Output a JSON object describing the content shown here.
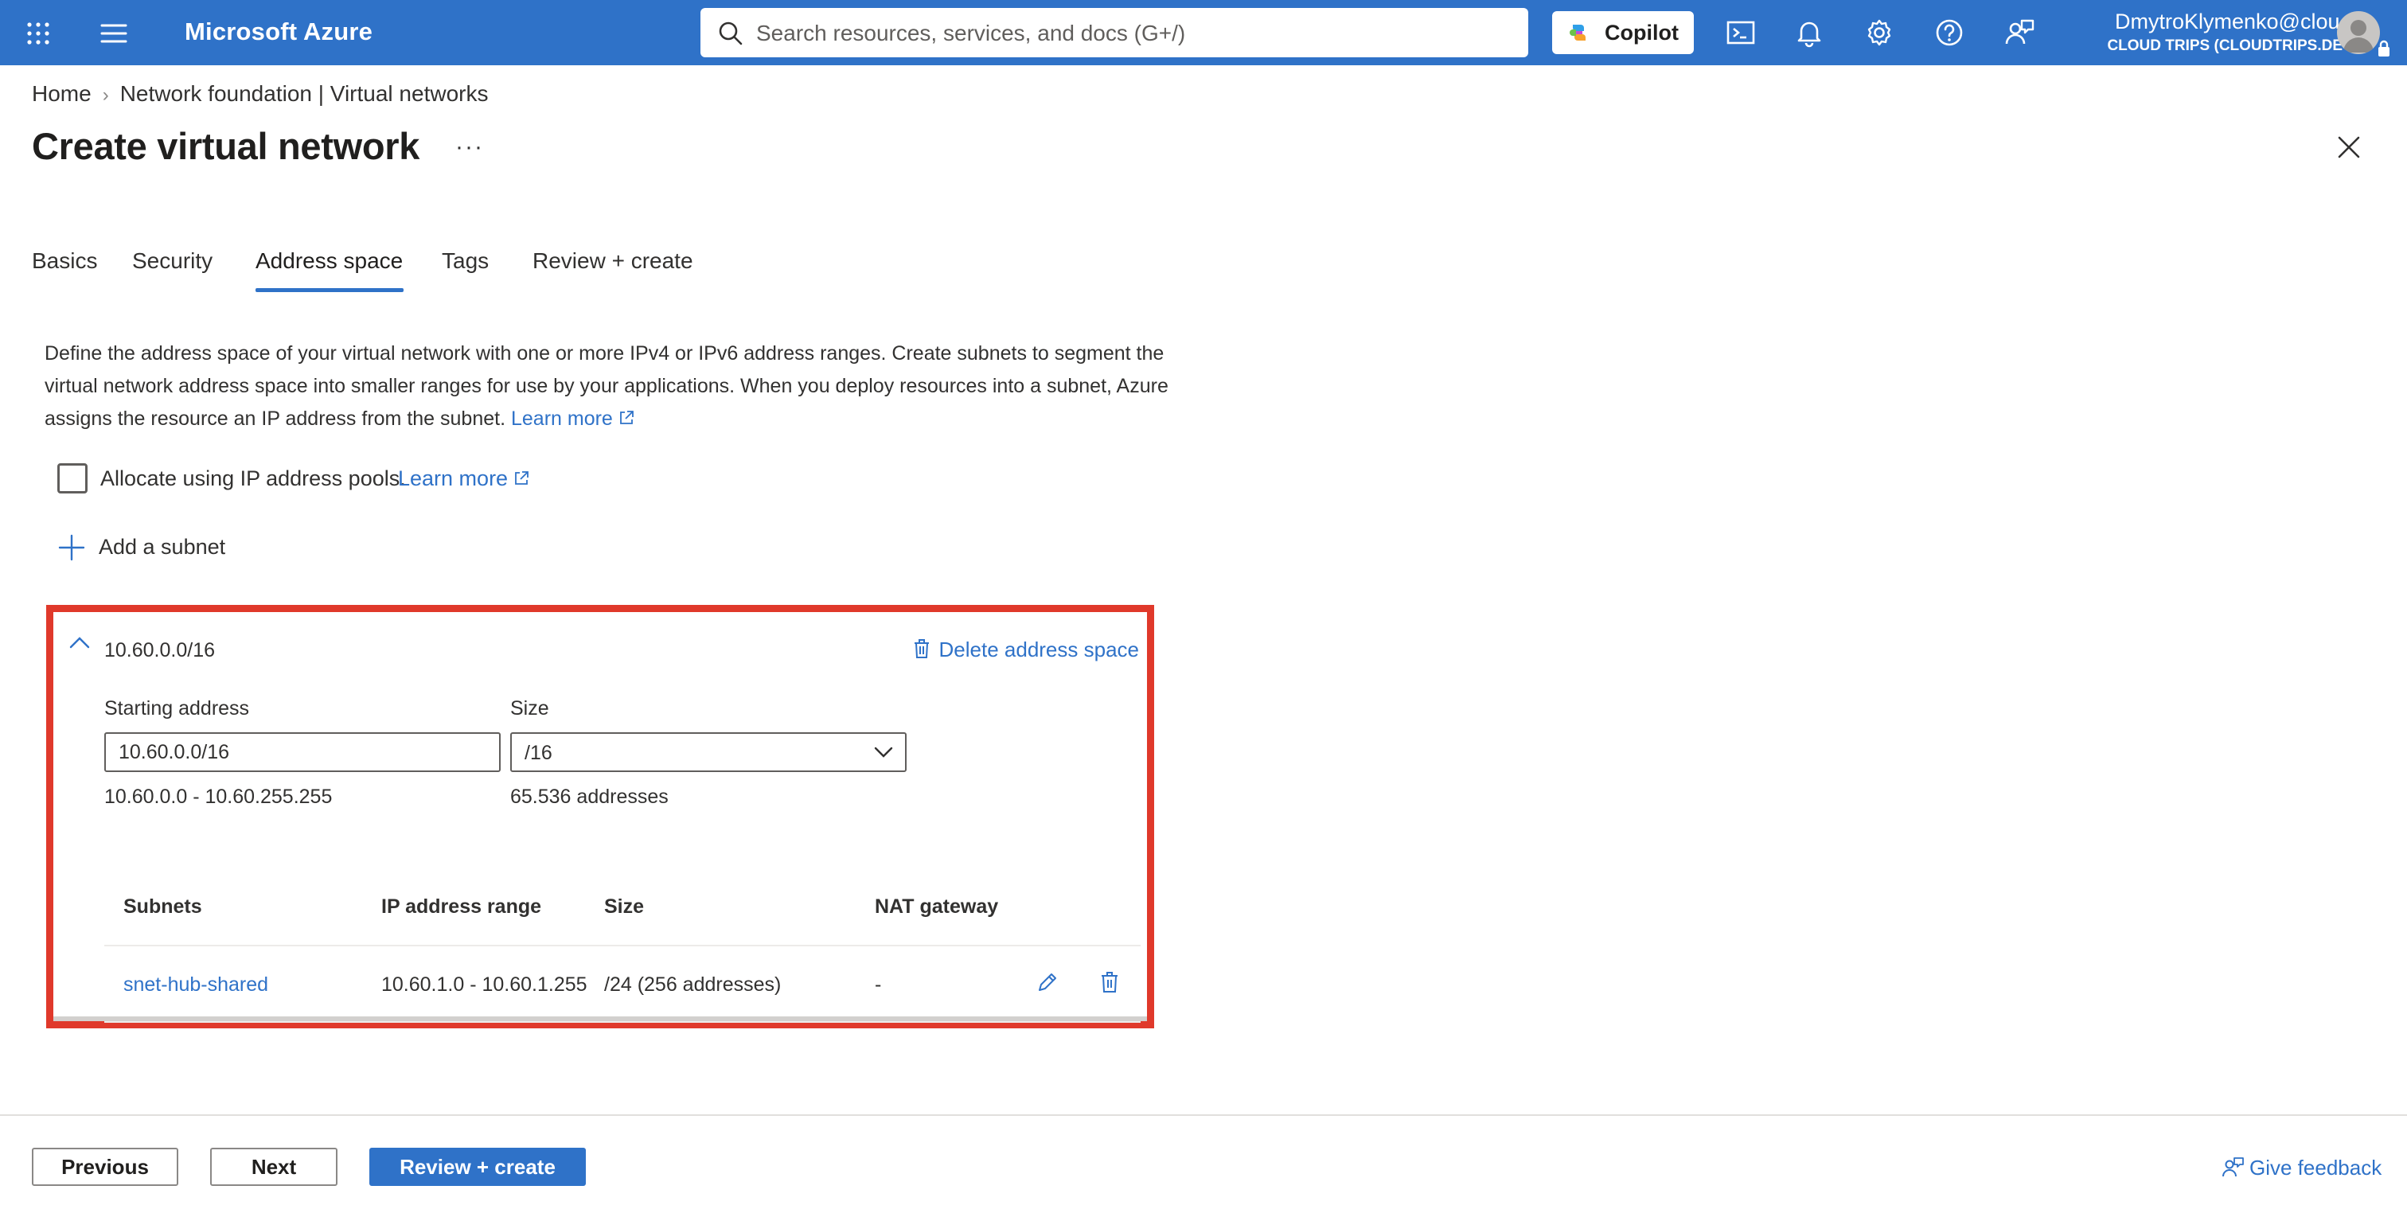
{
  "topbar": {
    "brand": "Microsoft Azure",
    "search_placeholder": "Search resources, services, and docs (G+/)",
    "copilot_label": "Copilot",
    "user_name": "DmytroKlymenko@clou...",
    "user_tenant": "CLOUD TRIPS (CLOUDTRIPS.DEV)"
  },
  "breadcrumb": {
    "home": "Home",
    "separator": "›",
    "current": "Network foundation | Virtual networks"
  },
  "page": {
    "title": "Create virtual network",
    "more": "···"
  },
  "tabs": {
    "basics": "Basics",
    "security": "Security",
    "address_space": "Address space",
    "tags": "Tags",
    "review": "Review + create"
  },
  "description": {
    "text": "Define the address space of your virtual network with one or more IPv4 or IPv6 address ranges. Create subnets to segment the virtual network address space into smaller ranges for use by your applications. When you deploy resources into a subnet, Azure assigns the resource an IP address from the subnet.",
    "learn_more": "Learn more"
  },
  "allocate": {
    "label": "Allocate using IP address pools.",
    "learn_more": "Learn more",
    "checked": false
  },
  "add_subnet_label": "Add a subnet",
  "address_space": {
    "cidr": "10.60.0.0/16",
    "delete_label": "Delete address space",
    "starting_address_label": "Starting address",
    "starting_address_value": "10.60.0.0/16",
    "size_label": "Size",
    "size_value": "/16",
    "range_text": "10.60.0.0 - 10.60.255.255",
    "address_count_text": "65.536 addresses",
    "table": {
      "headers": [
        "Subnets",
        "IP address range",
        "Size",
        "NAT gateway"
      ],
      "rows": [
        {
          "name": "snet-hub-shared",
          "range": "10.60.1.0 - 10.60.1.255",
          "size": "/24 (256 addresses)",
          "nat": "-"
        }
      ]
    }
  },
  "footer": {
    "previous": "Previous",
    "next": "Next",
    "review_create": "Review + create",
    "feedback": "Give feedback"
  },
  "colors": {
    "accent": "#2f72c8",
    "highlight_border": "#e0392b"
  }
}
